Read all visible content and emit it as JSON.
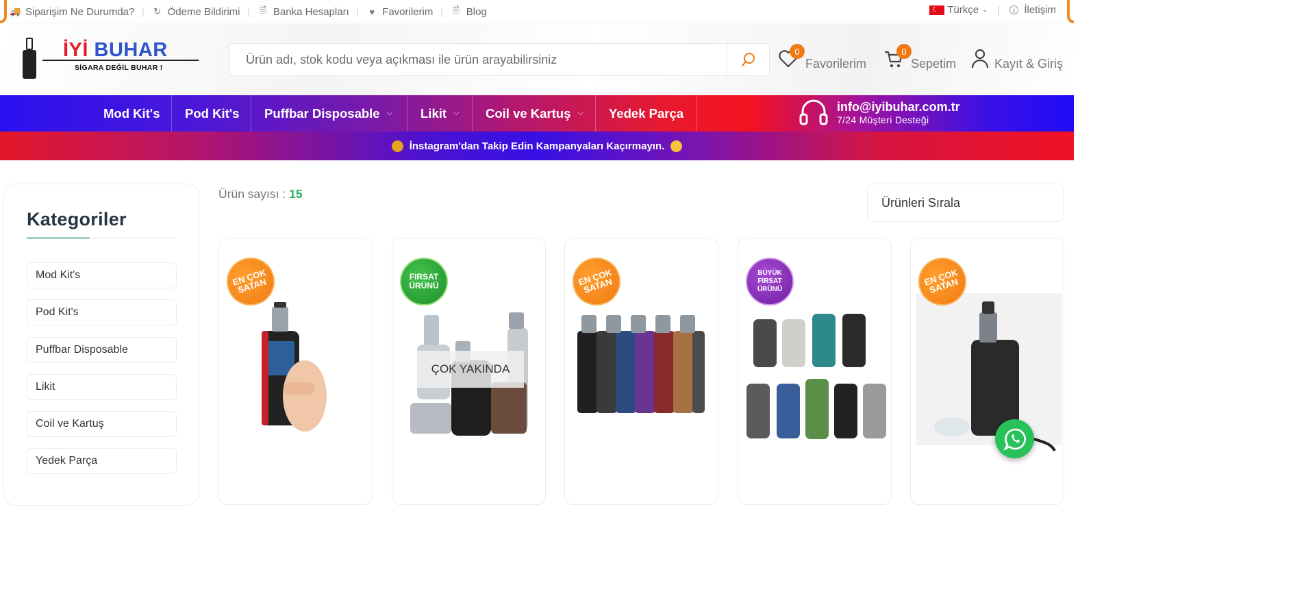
{
  "topbar": {
    "links": [
      "Siparişim Ne Durumda?",
      "Ödeme Bildirimi",
      "Banka Hesapları",
      "Favorilerim",
      "Blog"
    ],
    "language": "Türkçe",
    "contact": "İletişim"
  },
  "header": {
    "logo_brand_red": "İYİ",
    "logo_brand_blue": "BUHAR",
    "logo_tagline": "SİGARA DEĞİL BUHAR !",
    "search_placeholder": "Ürün adı, stok kodu veya açıkması ile ürün arayabilirsiniz",
    "favorites_label": "Favorilerim",
    "favorites_count": "0",
    "cart_label": "Sepetim",
    "cart_count": "0",
    "account_label": "Kayıt & Giriş"
  },
  "nav": {
    "items": [
      "Mod Kit's",
      "Pod Kit's",
      "Puffbar Disposable",
      "Likit",
      "Coil ve Kartuş",
      "Yedek Parça"
    ],
    "support_email": "info@iyibuhar.com.tr",
    "support_text": "7/24 Müşteri Desteği"
  },
  "promo": {
    "text": "İnstagram'dan Takip Edin Kampanyaları Kaçırmayın."
  },
  "sidebar": {
    "title": "Kategoriler",
    "categories": [
      "Mod Kit's",
      "Pod Kit's",
      "Puffbar Disposable",
      "Likit",
      "Coil ve Kartuş",
      "Yedek Parça"
    ]
  },
  "main": {
    "count_label": "Ürün sayısı :",
    "count_value": "15",
    "sort_label": "Ürünleri Sırala",
    "products": [
      {
        "badge": "EN ÇOK SATAN"
      },
      {
        "badge": "FIRSAT ÜRÜNÜ",
        "overlay": "ÇOK YAKINDA"
      },
      {
        "badge": "EN ÇOK SATAN"
      },
      {
        "badge": "BÜYÜK FIRSAT ÜRÜNÜ"
      },
      {
        "badge": "EN ÇOK SATAN"
      }
    ]
  },
  "colors": {
    "accent_orange": "#f07a12",
    "count_green": "#2dab5f",
    "whatsapp": "#29c25a"
  }
}
